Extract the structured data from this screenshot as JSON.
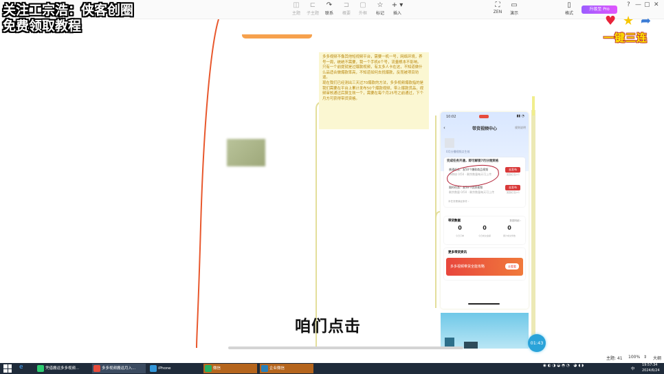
{
  "overlay": {
    "line1": "关注工宗浩：侠客创圈",
    "line2": "免费领取教程",
    "sticker_text": "一键三连"
  },
  "toolbar": {
    "items": [
      {
        "label": "主题",
        "icon": "◫"
      },
      {
        "label": "子主题",
        "icon": "⊏"
      },
      {
        "label": "联系",
        "icon": "↷"
      },
      {
        "label": "概要",
        "icon": "⊐"
      },
      {
        "label": "外框",
        "icon": "▢"
      },
      {
        "label": "标记",
        "icon": "☆"
      },
      {
        "label": "插入",
        "icon": "+ ▾"
      }
    ],
    "right": [
      {
        "label": "ZEN",
        "icon": "⛶"
      },
      {
        "label": "演示",
        "icon": "▭"
      },
      {
        "label": "格式",
        "icon": "▯"
      }
    ],
    "pro_label": "升级至 Pro",
    "window_controls": [
      "?",
      "—",
      "▢",
      "✕"
    ]
  },
  "note": {
    "paragraphs": [
      "多多视频不像其他短视频平台，需要一机一号，网络环境，养号一周，统统不需要，我一个手机6个号，流量根本不影响。",
      "只有一个前提就是过爆款视频，有太多人卡在这，不知道做什么品适合做爆款率高，不知道如何去找爆款，反而被项目劝退。",
      "现在我们已经测出三天过70爆款的方法，多多视频爆款指的是我们需要在平台上累计发布50个爆款视频，带上爆款货品，视频审核通过后算生效一个，需要在每个月25号之前通过，下个月方可获得带货资格。"
    ]
  },
  "phone": {
    "time": "10:02",
    "title": "带货视频中心",
    "rule": "规则说明",
    "sub": "0月分播视频点生效",
    "task_title": "完成任务开通，即可解锁7月分佣资格",
    "tasks": [
      {
        "line1": "普通任务：发50个爆款商品视频",
        "line2": "待审核 0/50 · 剩余数量每天可上传",
        "btn": "去发布",
        "small": "奖励红包×1"
      },
      {
        "line1": "限时任务：发50个优质视频",
        "line2": "剩余数量 0/50 · 剩余数量每天可上传",
        "btn": "去发布",
        "small": "奖励红包×1"
      }
    ],
    "task_more": "本任务需满足条件 ›",
    "data_title": "带货数据",
    "data_link": "数据明细 ›",
    "stats": [
      {
        "num": "0",
        "label": "今日订单"
      },
      {
        "num": "0",
        "label": "今日成交金额"
      },
      {
        "num": "0",
        "label": "累计成交件数"
      }
    ],
    "promo_title": "更多带货资讯",
    "promo_text": "多多视频带货全能攻略",
    "promo_btn": "去看看"
  },
  "timer": "01:43",
  "caption": "咱们点击",
  "statusbar": {
    "topics": "主题: 41",
    "zoom": "100%",
    "size": "大纲"
  },
  "taskbar": {
    "items": [
      {
        "label": "凭借搬运多多视频...",
        "color": "#2ecc71"
      },
      {
        "label": "多多视频搬运月入...",
        "color": "#e74c3c"
      },
      {
        "label": "iPhone",
        "color": "#3498db"
      },
      {
        "label": "微信",
        "color": "#27ae60"
      },
      {
        "label": "企业微信",
        "color": "#2980b9"
      }
    ],
    "time": "19:57:34",
    "date": "2024/6/24",
    "ime": "中"
  }
}
